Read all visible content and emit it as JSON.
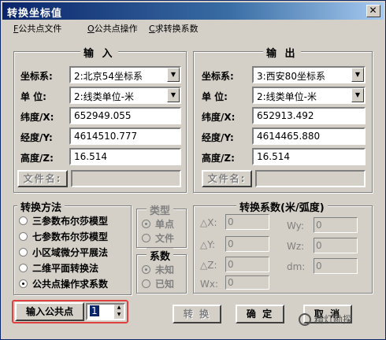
{
  "window": {
    "title": "转换坐标值",
    "close_glyph": "✕"
  },
  "menu": [
    {
      "hotkey": "F",
      "rest": "公共点文件"
    },
    {
      "hotkey": "O",
      "rest": "公共点操作"
    },
    {
      "hotkey": "C",
      "rest": "求转换系数"
    }
  ],
  "input_panel": {
    "title": "输 入",
    "coord_label": "坐标系:",
    "coord_value": "2:北京54坐标系",
    "unit_label": "单 位:",
    "unit_value": "2:线类单位-米",
    "lat_label": "纬度/X:",
    "lat_value": "652949.055",
    "lon_label": "经度/Y:",
    "lon_value": "4614510.777",
    "alt_label": "高度/Z:",
    "alt_value": "16.514",
    "file_button": "文件名:",
    "file_value": ""
  },
  "output_panel": {
    "title": "输 出",
    "coord_label": "坐标系:",
    "coord_value": "3:西安80坐标系",
    "unit_label": "单 位:",
    "unit_value": "2:线类单位-米",
    "lat_label": "纬度/X:",
    "lat_value": "652913.492",
    "lon_label": "经度/Y:",
    "lon_value": "4614465.880",
    "alt_label": "高度/Z:",
    "alt_value": "16.514",
    "file_button": "文件名:",
    "file_value": ""
  },
  "method": {
    "title": "转换方法",
    "options": [
      "三参数布尔莎模型",
      "七参数布尔莎模型",
      "小区域微分平展法",
      "二维平面转换法",
      "公共点操作求系数"
    ],
    "selected_index": 4
  },
  "type_group": {
    "title": "类型",
    "options": [
      "单点",
      "文件"
    ],
    "selected_index": 0
  },
  "coef_group": {
    "title": "系数",
    "options": [
      "未知",
      "已知"
    ],
    "selected_index": 0
  },
  "coefficients": {
    "title": "转换系数(米/弧度)",
    "labels": {
      "dx": "△X:",
      "dy": "△Y:",
      "dz": "△Z:",
      "wx": "Wx:",
      "wy": "Wy:",
      "wz": "Wz:",
      "dm": "dm:"
    },
    "values": {
      "dx": "0",
      "dy": "0",
      "dz": "0",
      "wx": "0",
      "wy": "0",
      "wz": "0",
      "dm": "0"
    }
  },
  "bottom": {
    "input_common_point": "输入公共点",
    "spin_value": "1",
    "convert": "转 换",
    "ok": "确 定",
    "cancel": "取 消"
  },
  "watermark": "精灯勘探"
}
